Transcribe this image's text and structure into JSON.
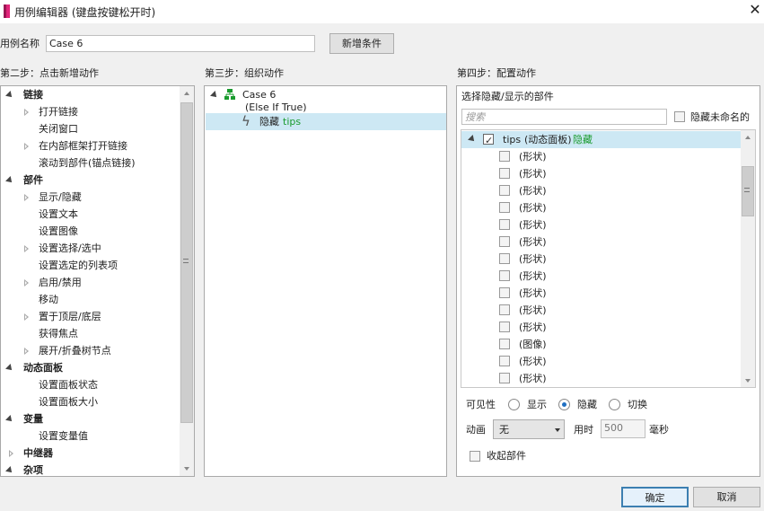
{
  "window": {
    "title": "用例编辑器 (键盘按键松开时)",
    "close_glyph": "✕"
  },
  "case_name": {
    "label": "用例名称",
    "value": "Case 6",
    "add_condition_label": "新增条件"
  },
  "step2": {
    "heading": "第二步：点击新增动作",
    "items": [
      {
        "label": "链接",
        "kind": "group"
      },
      {
        "label": "打开链接",
        "kind": "expandable"
      },
      {
        "label": "关闭窗口",
        "kind": "leaf"
      },
      {
        "label": "在内部框架打开链接",
        "kind": "expandable"
      },
      {
        "label": "滚动到部件(锚点链接)",
        "kind": "leaf"
      },
      {
        "label": "部件",
        "kind": "group"
      },
      {
        "label": "显示/隐藏",
        "kind": "expandable"
      },
      {
        "label": "设置文本",
        "kind": "leaf"
      },
      {
        "label": "设置图像",
        "kind": "leaf"
      },
      {
        "label": "设置选择/选中",
        "kind": "expandable"
      },
      {
        "label": "设置选定的列表项",
        "kind": "leaf"
      },
      {
        "label": "启用/禁用",
        "kind": "expandable"
      },
      {
        "label": "移动",
        "kind": "leaf"
      },
      {
        "label": "置于顶层/底层",
        "kind": "expandable"
      },
      {
        "label": "获得焦点",
        "kind": "leaf"
      },
      {
        "label": "展开/折叠树节点",
        "kind": "expandable"
      },
      {
        "label": "动态面板",
        "kind": "group"
      },
      {
        "label": "设置面板状态",
        "kind": "leaf"
      },
      {
        "label": "设置面板大小",
        "kind": "leaf"
      },
      {
        "label": "变量",
        "kind": "group"
      },
      {
        "label": "设置变量值",
        "kind": "leaf"
      },
      {
        "label": "中继器",
        "kind": "group-closed"
      },
      {
        "label": "杂项",
        "kind": "group"
      }
    ]
  },
  "step3": {
    "heading": "第三步：组织动作",
    "case_label": "Case 6",
    "case_condition": "(Else If True)",
    "action_prefix": "隐藏",
    "action_target": "tips"
  },
  "step4": {
    "heading": "第四步：配置动作",
    "subheading": "选择隐藏/显示的部件",
    "search_placeholder": "搜索",
    "hide_unnamed_label": "隐藏未命名的",
    "root": {
      "name": "tips",
      "type": "(动态面板)",
      "action": "隐藏",
      "checked": true
    },
    "children": [
      "(形状)",
      "(形状)",
      "(形状)",
      "(形状)",
      "(形状)",
      "(形状)",
      "(形状)",
      "(形状)",
      "(形状)",
      "(形状)",
      "(形状)",
      "(图像)",
      "(形状)",
      "(形状)"
    ],
    "visibility": {
      "label": "可见性",
      "options": [
        "显示",
        "隐藏",
        "切换"
      ],
      "selected": "隐藏"
    },
    "animation": {
      "label": "动画",
      "value": "无",
      "duration_label": "用时",
      "duration_value": "500",
      "unit": "毫秒"
    },
    "collapse_label": "收起部件"
  },
  "footer": {
    "ok_label": "确定",
    "cancel_label": "取消"
  },
  "colors": {
    "accent": "#1f6fc2",
    "green_text": "#1a9b2e",
    "selected_row": "#cde8f4",
    "ok_border": "#3c7fb1"
  }
}
